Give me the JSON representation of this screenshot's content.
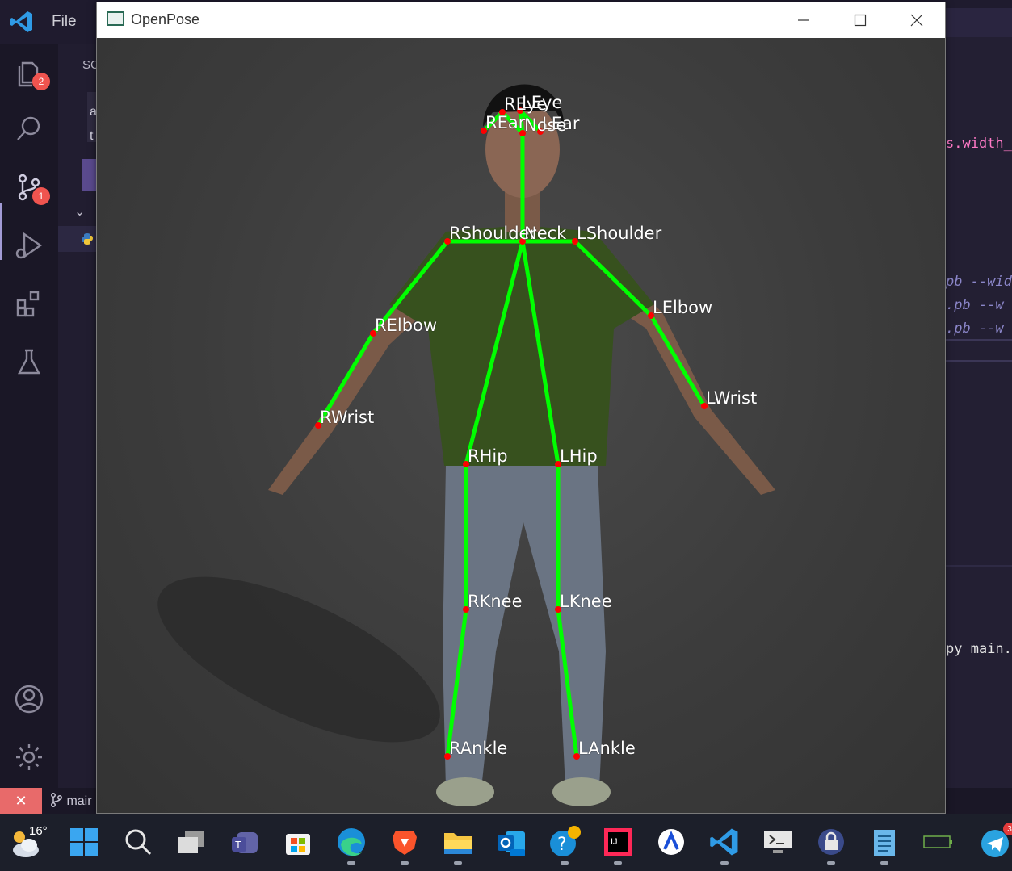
{
  "vscode": {
    "menu_file": "File",
    "explorer_badge": "2",
    "scm_badge": "1",
    "side_title": "SC",
    "side_lines": [
      "a",
      "t"
    ],
    "branch": "mair",
    "right_code": [
      {
        "text": "s.width_",
        "color": "#ff79c6"
      },
      {
        "text": "pb --wid",
        "color": "#8b86c9"
      },
      {
        "text": ".pb --w",
        "color": "#8b86c9"
      },
      {
        "text": ".pb --w",
        "color": "#8b86c9"
      },
      {
        "text": "py main.",
        "color": "#e6e6e6"
      }
    ]
  },
  "window": {
    "title": "OpenPose",
    "minimize_icon": "minimize-icon",
    "maximize_icon": "maximize-icon",
    "close_icon": "close-icon"
  },
  "pose": {
    "keypoint_color": "#ff0000",
    "limb_color": "#00ff00",
    "labels": {
      "reye": "REye",
      "leye": "LEye",
      "rear": "REar",
      "nose": "Nose",
      "lear": "LEar",
      "rshoulder": "RShoulder",
      "neck": "Neck",
      "lshoulder": "LShoulder",
      "relbow": "RElbow",
      "lelbow": "LElbow",
      "rwrist": "RWrist",
      "lwrist": "LWrist",
      "rhip": "RHip",
      "lhip": "LHip",
      "rknee": "RKnee",
      "lknee": "LKnee",
      "rankle": "RAnkle",
      "lankle": "LAnkle"
    }
  },
  "taskbar": {
    "temperature": "16°",
    "notification_badge": "3",
    "apps": [
      "start-icon",
      "search-icon",
      "task-view-icon",
      "teams-icon",
      "store-icon",
      "edge-icon",
      "brave-icon",
      "file-explorer-icon",
      "outlook-icon",
      "help-icon",
      "intellij-icon",
      "arc-icon",
      "vscode-icon",
      "terminal-icon",
      "keepass-icon",
      "notepad-icon",
      "battery-icon",
      "telegram-icon"
    ]
  }
}
